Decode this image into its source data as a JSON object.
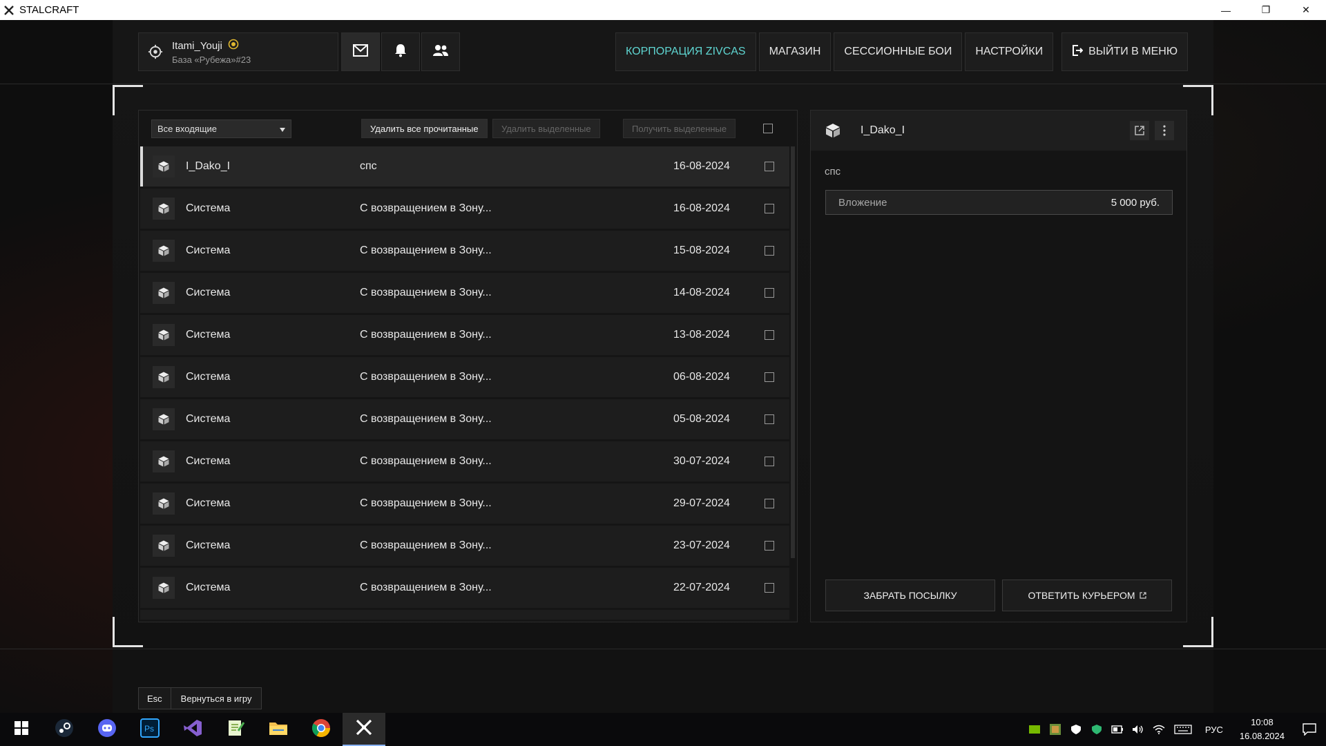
{
  "window": {
    "title": "STALCRAFT",
    "controls": {
      "minimize": "—",
      "restore": "❐",
      "close": "✕"
    }
  },
  "header": {
    "profile": {
      "name": "Itami_Youji",
      "base": "База «Рубежа»#23"
    },
    "nav": [
      {
        "label": "КОРПОРАЦИЯ ZIVCAS",
        "accent": true
      },
      {
        "label": "МАГАЗИН"
      },
      {
        "label": "СЕССИОННЫЕ БОИ"
      },
      {
        "label": "НАСТРОЙКИ"
      },
      {
        "label": "ВЫЙТИ В МЕНЮ"
      }
    ],
    "accent_color": "#5fd6d2"
  },
  "inbox": {
    "filter": "Все входящие",
    "delete_read": "Удалить все прочитанные",
    "delete_selected": "Удалить выделенные",
    "get_selected": "Получить выделенные",
    "rows": [
      {
        "sender": "I_Dako_I",
        "subject": "спс",
        "date": "16-08-2024",
        "selected": true
      },
      {
        "sender": "Система",
        "subject": "С возвращением в Зону...",
        "date": "16-08-2024"
      },
      {
        "sender": "Система",
        "subject": "С возвращением в Зону...",
        "date": "15-08-2024"
      },
      {
        "sender": "Система",
        "subject": "С возвращением в Зону...",
        "date": "14-08-2024"
      },
      {
        "sender": "Система",
        "subject": "С возвращением в Зону...",
        "date": "13-08-2024"
      },
      {
        "sender": "Система",
        "subject": "С возвращением в Зону...",
        "date": "06-08-2024"
      },
      {
        "sender": "Система",
        "subject": "С возвращением в Зону...",
        "date": "05-08-2024"
      },
      {
        "sender": "Система",
        "subject": "С возвращением в Зону...",
        "date": "30-07-2024"
      },
      {
        "sender": "Система",
        "subject": "С возвращением в Зону...",
        "date": "29-07-2024"
      },
      {
        "sender": "Система",
        "subject": "С возвращением в Зону...",
        "date": "23-07-2024"
      },
      {
        "sender": "Система",
        "subject": "С возвращением в Зону...",
        "date": "22-07-2024"
      }
    ]
  },
  "detail": {
    "sender": "I_Dako_I",
    "body": "спс",
    "attachment_label": "Вложение",
    "attachment_value": "5 000 руб.",
    "take_button": "ЗАБРАТЬ ПОСЫЛКУ",
    "reply_button": "ОТВЕТИТЬ КУРЬЕРОМ"
  },
  "footer": {
    "key": "Esc",
    "label": "Вернуться в игру"
  },
  "taskbar": {
    "apps": [
      "windows-start",
      "steam",
      "discord",
      "photoshop",
      "visual-studio",
      "notepad-plus",
      "file-explorer",
      "chrome",
      "stalcraft"
    ],
    "language": "РУС",
    "time": "10:08",
    "date": "16.08.2024"
  }
}
